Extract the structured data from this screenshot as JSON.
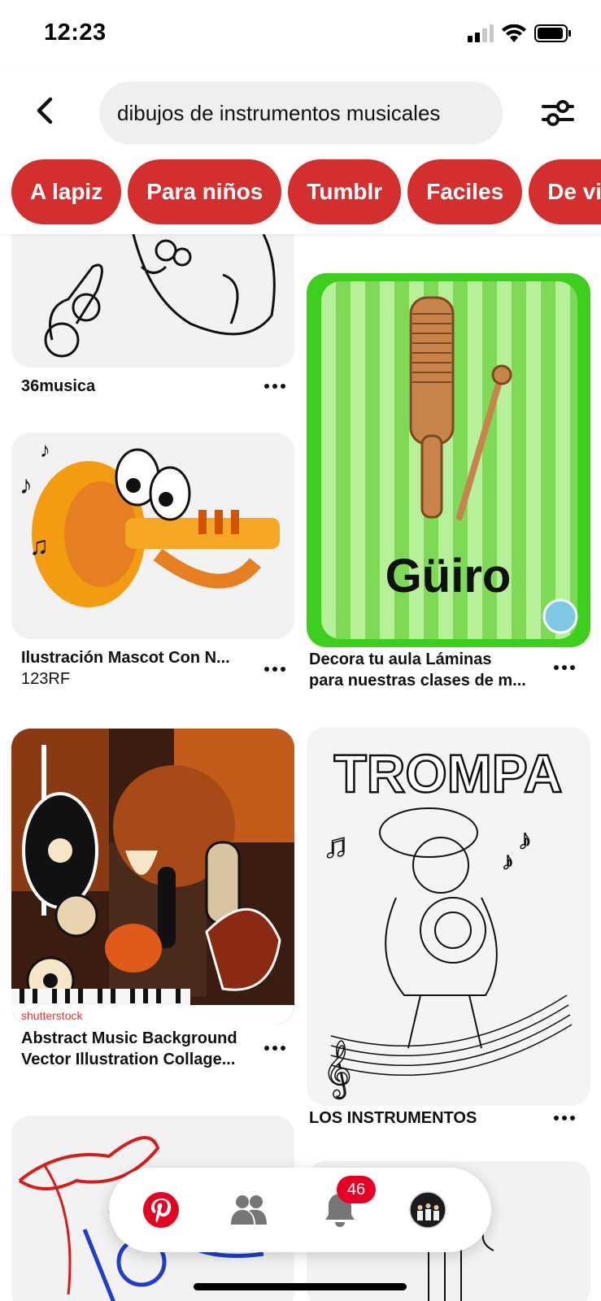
{
  "status_bar": {
    "time": "12:23"
  },
  "search": {
    "query": "dibujos de instrumentos musicales"
  },
  "chips": [
    "A lapiz",
    "Para niños",
    "Tumblr",
    "Faciles",
    "De vie"
  ],
  "pins": {
    "p1": {
      "title": "36musica"
    },
    "p2": {
      "title": "Ilustración Mascot Con N...",
      "source": "123RF",
      "image_text": ""
    },
    "p3": {
      "title_line1": "Decora tu aula Láminas",
      "title_line2": "para nuestras clases de m...",
      "image_text": "Güiro"
    },
    "p4": {
      "title_line1": "Abstract Music Background",
      "title_line2": "Vector Illustration Collage...",
      "watermark": "shutterstock"
    },
    "p5": {
      "title": "LOS INSTRUMENTOS",
      "image_text": "TROMPA"
    }
  },
  "bottom_nav": {
    "items": [
      "pinterest-home-icon",
      "following-icon",
      "notifications-icon",
      "profile-avatar"
    ],
    "notification_count": "46"
  },
  "colors": {
    "accent": "#e60023",
    "chip": "#d32f2f"
  }
}
